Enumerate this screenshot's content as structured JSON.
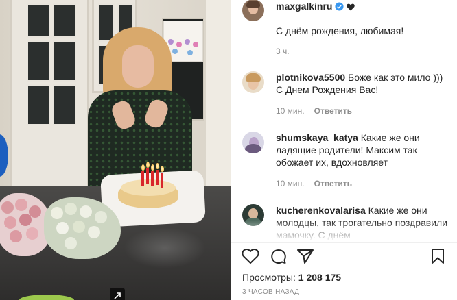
{
  "post": {
    "author": "maxgalkinru",
    "caption": "С днём рождения, любимая!",
    "caption_time": "3 ч.",
    "views_label": "Просмотры:",
    "views_count": "1 208 175",
    "timestamp": "3 ЧАСОВ НАЗАД"
  },
  "comments": [
    {
      "username": "plotnikova5500",
      "text": "Боже как это мило ))) С Днем Рождения Вас!",
      "time": "10 мин.",
      "reply_label": "Ответить"
    },
    {
      "username": "shumskaya_katya",
      "text": "Какие же они ладящие родители! Максим так обожает их, вдохновляет",
      "time": "10 мин.",
      "reply_label": "Ответить"
    },
    {
      "username": "kucherenkovalarisa",
      "text": "Какие же они молодцы, так трогательно поздравили мамочку. С днём"
    }
  ],
  "icons": {
    "verified": "verified-badge-icon",
    "heart_emoji": "black-heart-icon",
    "like": "heart-outline-icon",
    "comment": "comment-bubble-icon",
    "share": "paper-plane-icon",
    "save": "bookmark-icon",
    "expand": "expand-arrow-icon"
  },
  "colors": {
    "verified": "#3897f0",
    "text": "#262626",
    "muted": "#8e8e8e"
  }
}
